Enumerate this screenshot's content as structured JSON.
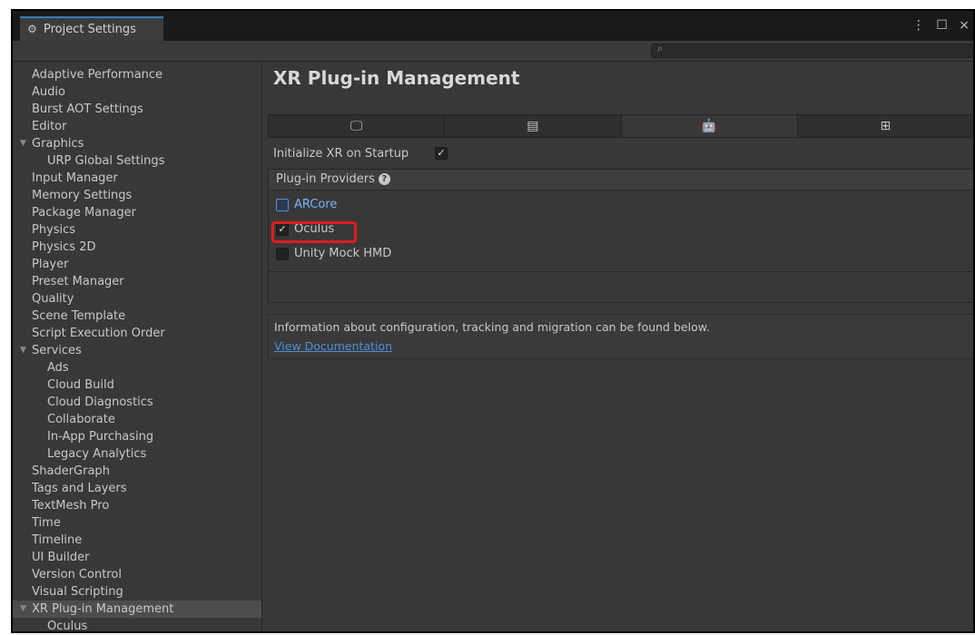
{
  "window": {
    "tab_title": "Project Settings",
    "controls": "⋮ ☐ ×"
  },
  "search": {
    "placeholder": ""
  },
  "sidebar": {
    "items": [
      {
        "label": "Adaptive Performance",
        "indent": 0,
        "fold": false
      },
      {
        "label": "Audio",
        "indent": 0,
        "fold": false
      },
      {
        "label": "Burst AOT Settings",
        "indent": 0,
        "fold": false
      },
      {
        "label": "Editor",
        "indent": 0,
        "fold": false
      },
      {
        "label": "Graphics",
        "indent": 0,
        "fold": true
      },
      {
        "label": "URP Global Settings",
        "indent": 1,
        "fold": false
      },
      {
        "label": "Input Manager",
        "indent": 0,
        "fold": false
      },
      {
        "label": "Memory Settings",
        "indent": 0,
        "fold": false
      },
      {
        "label": "Package Manager",
        "indent": 0,
        "fold": false
      },
      {
        "label": "Physics",
        "indent": 0,
        "fold": false
      },
      {
        "label": "Physics 2D",
        "indent": 0,
        "fold": false
      },
      {
        "label": "Player",
        "indent": 0,
        "fold": false
      },
      {
        "label": "Preset Manager",
        "indent": 0,
        "fold": false
      },
      {
        "label": "Quality",
        "indent": 0,
        "fold": false
      },
      {
        "label": "Scene Template",
        "indent": 0,
        "fold": false
      },
      {
        "label": "Script Execution Order",
        "indent": 0,
        "fold": false
      },
      {
        "label": "Services",
        "indent": 0,
        "fold": true
      },
      {
        "label": "Ads",
        "indent": 1,
        "fold": false
      },
      {
        "label": "Cloud Build",
        "indent": 1,
        "fold": false
      },
      {
        "label": "Cloud Diagnostics",
        "indent": 1,
        "fold": false
      },
      {
        "label": "Collaborate",
        "indent": 1,
        "fold": false
      },
      {
        "label": "In-App Purchasing",
        "indent": 1,
        "fold": false
      },
      {
        "label": "Legacy Analytics",
        "indent": 1,
        "fold": false
      },
      {
        "label": "ShaderGraph",
        "indent": 0,
        "fold": false
      },
      {
        "label": "Tags and Layers",
        "indent": 0,
        "fold": false
      },
      {
        "label": "TextMesh Pro",
        "indent": 0,
        "fold": false
      },
      {
        "label": "Time",
        "indent": 0,
        "fold": false
      },
      {
        "label": "Timeline",
        "indent": 0,
        "fold": false
      },
      {
        "label": "UI Builder",
        "indent": 0,
        "fold": false
      },
      {
        "label": "Version Control",
        "indent": 0,
        "fold": false
      },
      {
        "label": "Visual Scripting",
        "indent": 0,
        "fold": false
      },
      {
        "label": "XR Plug-in Management",
        "indent": 0,
        "fold": true,
        "selected": true
      },
      {
        "label": "Oculus",
        "indent": 1,
        "fold": false
      }
    ]
  },
  "main": {
    "title": "XR Plug-in Management",
    "platform_tabs": [
      {
        "icon": "desktop-icon",
        "glyph": "🖵",
        "active": false
      },
      {
        "icon": "server-icon",
        "glyph": "▤",
        "active": false
      },
      {
        "icon": "android-icon",
        "glyph": "🤖",
        "active": true
      },
      {
        "icon": "windows-icon",
        "glyph": "⊞",
        "active": false
      }
    ],
    "init_label": "Initialize XR on Startup",
    "init_checked": true,
    "providers_header": "Plug-in Providers",
    "providers": [
      {
        "label": "ARCore",
        "checked": false,
        "link": true
      },
      {
        "label": "Oculus",
        "checked": true,
        "link": false
      },
      {
        "label": "Unity Mock HMD",
        "checked": false,
        "link": false
      }
    ],
    "info_text": "Information about configuration, tracking and migration can be found below.",
    "doc_link": "View Documentation"
  },
  "colors": {
    "highlight": "#e01d1d",
    "link": "#4e8fd6",
    "accent": "#3a79bb"
  }
}
